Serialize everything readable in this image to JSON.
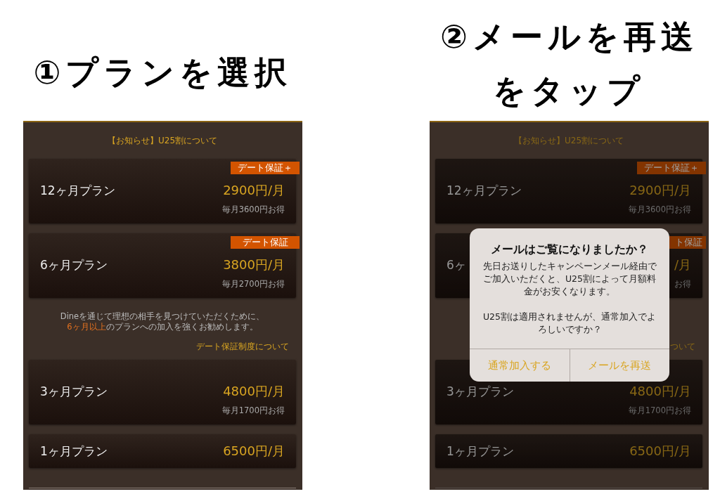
{
  "steps": [
    {
      "heading": [
        "①プランを選択"
      ],
      "screen": {
        "notice": "【お知らせ】U25割について",
        "plans": [
          {
            "name": "12ヶ月プラン",
            "badge": "デート保証＋",
            "price": "2900円/月",
            "saving": "毎月3600円お得"
          },
          {
            "name": "6ヶ月プラン",
            "badge": "デート保証",
            "price": "3800円/月",
            "saving": "毎月2700円お得"
          },
          {
            "name": "3ヶ月プラン",
            "price": "4800円/月",
            "saving": "毎月1700円お得"
          },
          {
            "name": "1ヶ月プラン",
            "price": "6500円/月"
          }
        ],
        "info": "Dineを通じて理想の相手を見つけていただくために、\n**6ヶ月以上**のプランへの加入を強くお勧めします。",
        "info_link": "デート保証制度について"
      }
    },
    {
      "heading": [
        "②メールを再送",
        "をタップ"
      ],
      "screen": {
        "notice": "【お知らせ】U25割について",
        "plans": [
          {
            "name": "12ヶ月プラン",
            "badge": "デート保証＋",
            "price": "2900円/月",
            "saving": "毎月3600円お得"
          },
          {
            "name": "6ヶ",
            "badge": "ト保証",
            "price": "/月",
            "saving": "お得"
          },
          {
            "name": "3ヶ月プラン",
            "price": "4800円/月",
            "saving": "毎月1700円お得"
          },
          {
            "name": "1ヶ月プラン",
            "price": "6500円/月"
          }
        ],
        "info_link": "ついて",
        "dialog": {
          "title": "メールはご覧になりましたか？",
          "message": [
            "先日お送りしたキャンペーンメール経由で",
            "ご加入いただくと、U25割によって月額料",
            "金がお安くなります。",
            "U25割は適用されませんが、通常加入でよ",
            "ろしいですか？"
          ],
          "buttons": [
            "通常加入する",
            "メールを再送"
          ]
        }
      }
    }
  ]
}
